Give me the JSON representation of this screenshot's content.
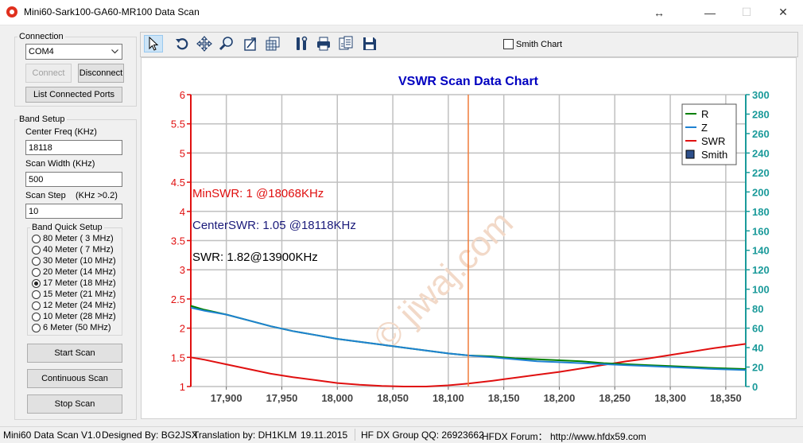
{
  "window": {
    "title": "Mini60-Sark100-GA60-MR100 Data Scan",
    "resize_glyph": "↔",
    "minimize_glyph": "—",
    "maximize_glyph": "☐",
    "close_glyph": "✕"
  },
  "connection": {
    "group_label": "Connection",
    "port_value": "COM4",
    "connect_label": "Connect",
    "disconnect_label": "Disconnect",
    "list_ports_label": "List Connected Ports"
  },
  "band_setup": {
    "group_label": "Band Setup",
    "center_freq_label": "Center Freq  (KHz)",
    "center_freq_value": "18118",
    "scan_width_label": "Scan Width   (KHz)",
    "scan_width_value": "500",
    "scan_step_label": "Scan Step",
    "scan_step_hint": "(KHz >0.2)",
    "scan_step_value": "10",
    "quick_label": "Band Quick Setup",
    "bands": [
      {
        "label": "80 Meter (  3 MHz)",
        "checked": false
      },
      {
        "label": "40 Meter (  7 MHz)",
        "checked": false
      },
      {
        "label": "30 Meter (10 MHz)",
        "checked": false
      },
      {
        "label": "20 Meter (14 MHz)",
        "checked": false
      },
      {
        "label": "17 Meter (18 MHz)",
        "checked": true
      },
      {
        "label": "15 Meter (21 MHz)",
        "checked": false
      },
      {
        "label": "12 Meter (24 MHz)",
        "checked": false
      },
      {
        "label": "10 Meter (28 MHz)",
        "checked": false
      },
      {
        "label": "6 Meter  (50 MHz)",
        "checked": false
      }
    ],
    "start_label": "Start Scan",
    "continuous_label": "Continuous Scan",
    "stop_label": "Stop Scan"
  },
  "toolbar": {
    "smith_chart_label": "Smith Chart",
    "tools": [
      "pointer-icon",
      "undo-icon",
      "pan-icon",
      "zoom-icon",
      "export-image-icon",
      "grid-settings-icon",
      "tools-icon",
      "print-icon",
      "copy-data-icon",
      "save-icon"
    ]
  },
  "annotations": {
    "min_swr": "MinSWR: 1 @18068KHz",
    "center_swr": "CenterSWR: 1.05 @18118KHz",
    "swr_cursor": "SWR: 1.82@13900KHz",
    "watermark": "© jiwaj.com"
  },
  "chart_data": {
    "type": "line",
    "title": "VSWR Scan Data Chart",
    "xlim": [
      17868,
      18368
    ],
    "x_ticks": [
      "17,900",
      "17,950",
      "18,000",
      "18,050",
      "18,100",
      "18,150",
      "18,200",
      "18,250",
      "18,300",
      "18,350"
    ],
    "x_tick_values": [
      17900,
      17950,
      18000,
      18050,
      18100,
      18150,
      18200,
      18250,
      18300,
      18350
    ],
    "ylim_left": [
      1,
      6
    ],
    "y_ticks_left": [
      "1",
      "1.5",
      "2",
      "2.5",
      "3",
      "3.5",
      "4",
      "4.5",
      "5",
      "5.5",
      "6"
    ],
    "ylim_right": [
      0,
      300
    ],
    "y_ticks_right": [
      "0",
      "20",
      "40",
      "60",
      "80",
      "100",
      "120",
      "140",
      "160",
      "180",
      "200",
      "220",
      "240",
      "260",
      "280",
      "300"
    ],
    "cursor_x": 18118,
    "grid": true,
    "legend_position": "top-right",
    "legend": [
      {
        "name": "R",
        "color": "#008000",
        "kind": "line"
      },
      {
        "name": "Z",
        "color": "#1e82d2",
        "kind": "line"
      },
      {
        "name": "SWR",
        "color": "#e01010",
        "kind": "line"
      },
      {
        "name": "Smith",
        "color": "#2e4f8a",
        "kind": "box"
      }
    ],
    "x": [
      17868,
      17880,
      17900,
      17920,
      17940,
      17960,
      17980,
      18000,
      18020,
      18040,
      18060,
      18080,
      18100,
      18118,
      18140,
      18160,
      18180,
      18200,
      18220,
      18240,
      18260,
      18280,
      18300,
      18320,
      18340,
      18368
    ],
    "series": [
      {
        "name": "SWR",
        "axis": "left",
        "color": "#e01010",
        "values": [
          1.5,
          1.46,
          1.38,
          1.3,
          1.22,
          1.16,
          1.11,
          1.06,
          1.03,
          1.01,
          1.0,
          1.0,
          1.02,
          1.05,
          1.1,
          1.15,
          1.2,
          1.25,
          1.31,
          1.37,
          1.43,
          1.48,
          1.54,
          1.6,
          1.66,
          1.73
        ]
      },
      {
        "name": "R",
        "axis": "right",
        "color": "#008000",
        "values": [
          83,
          79,
          74,
          68,
          62,
          57,
          53,
          49,
          46,
          43,
          40,
          37,
          34,
          32,
          31,
          29,
          28,
          27,
          26,
          24,
          23,
          22,
          21,
          20,
          19,
          18
        ]
      },
      {
        "name": "Z",
        "axis": "right",
        "color": "#1e82d2",
        "values": [
          81,
          78,
          74,
          68,
          62,
          57,
          53,
          49,
          46,
          43,
          40,
          37,
          34,
          32,
          30,
          28,
          26,
          25,
          24,
          23,
          22,
          21,
          20,
          19,
          18,
          17
        ]
      }
    ]
  },
  "status": {
    "version": "Mini60 Data Scan V1.0",
    "designer": "Designed By: BG2JSX",
    "translation": "Translation by: DH1KLM",
    "date": "19.11.2015",
    "group": "HF DX Group QQ: 26923662",
    "forum": "HFDX Forum：  http://www.hfdx59.com"
  }
}
